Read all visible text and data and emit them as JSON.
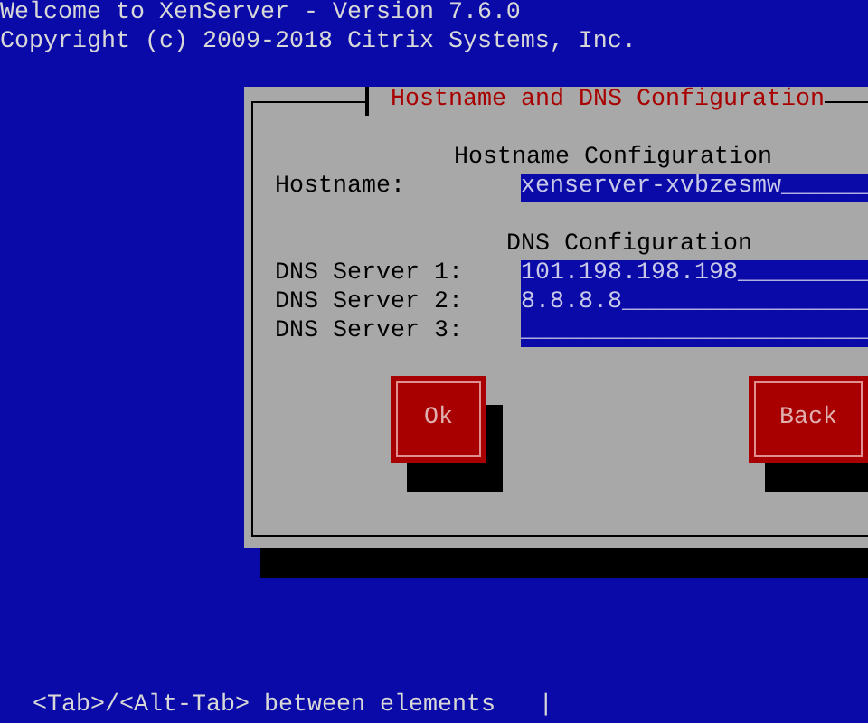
{
  "header": {
    "lines": [
      "Welcome to XenServer - Version 7.6.0",
      "Copyright (c) 2009-2018 Citrix Systems, Inc."
    ]
  },
  "dialog": {
    "title": "Hostname and DNS Configuration",
    "sections": [
      {
        "heading": "Hostname Configuration",
        "fields": [
          {
            "label": "Hostname:",
            "value": "xenserver-xvbzesmw______"
          }
        ]
      },
      {
        "heading": "DNS Configuration",
        "fields": [
          {
            "label": "DNS Server 1:",
            "value": "101.198.198.198_________"
          },
          {
            "label": "DNS Server 2:",
            "value": "8.8.8.8_________________"
          },
          {
            "label": "DNS Server 3:",
            "value": "________________________"
          }
        ]
      }
    ],
    "buttons": [
      {
        "label": "Ok"
      },
      {
        "label": "Back"
      }
    ]
  },
  "help_line": "<Tab>/<Alt-Tab> between elements   |"
}
